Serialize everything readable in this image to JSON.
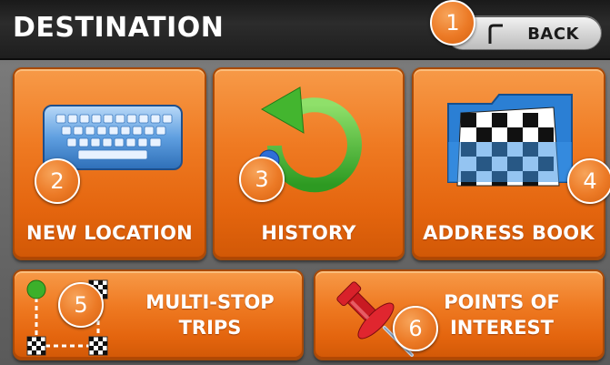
{
  "header": {
    "title": "DESTINATION",
    "back_label": "BACK"
  },
  "tiles": {
    "new_location": {
      "label": "NEW LOCATION",
      "icon": "keyboard-icon"
    },
    "history": {
      "label": "HISTORY",
      "icon": "history-arrow-icon"
    },
    "address_book": {
      "label": "ADDRESS BOOK",
      "icon": "checkered-flag-folder-icon"
    },
    "multi_stop": {
      "line1": "MULTI-STOP",
      "line2": "TRIPS",
      "icon": "route-stops-icon"
    },
    "poi": {
      "line1": "POINTS OF",
      "line2": "INTEREST",
      "icon": "push-pin-icon"
    }
  },
  "callouts": [
    "1",
    "2",
    "3",
    "4",
    "5",
    "6"
  ],
  "colors": {
    "accent": "#ef7a22",
    "header_bg": "#1e1e1e",
    "background": "#6a6a6a"
  }
}
